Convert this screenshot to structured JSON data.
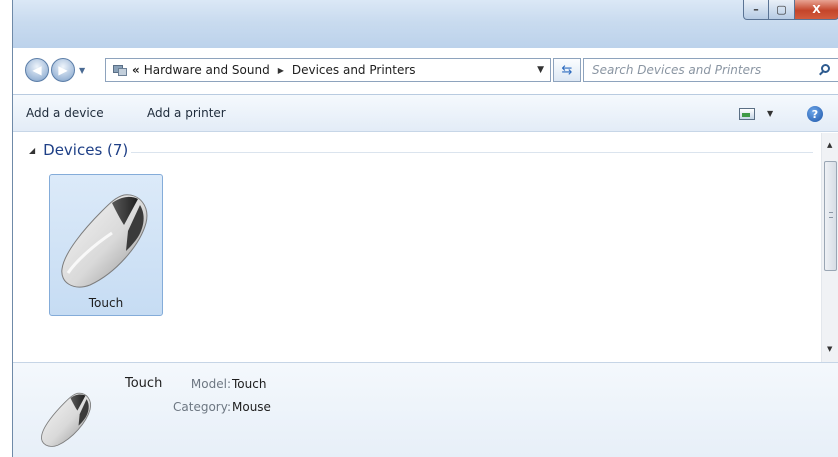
{
  "window": {
    "caption": {
      "minimize_glyph": "–",
      "maximize_glyph": "▢",
      "close_glyph": "X"
    }
  },
  "nav": {
    "back_glyph": "◀",
    "forward_glyph": "▶"
  },
  "address": {
    "overflow_chevron": "«",
    "breadcrumbs": [
      "Hardware and Sound",
      "Devices and Printers"
    ],
    "separator_glyph": "▶",
    "dropdown_glyph": "▼",
    "refresh_glyph": "⇆"
  },
  "search": {
    "placeholder": "Search Devices and Printers"
  },
  "commandbar": {
    "add_device": "Add a device",
    "add_printer": "Add a printer",
    "view_dropdown_glyph": "▼",
    "help_glyph": "?"
  },
  "content": {
    "group": {
      "arrow_glyph": "◢",
      "title": "Devices (7)"
    },
    "devices": [
      {
        "label": "Touch",
        "icon": "mouse-icon"
      }
    ]
  },
  "scrollbar": {
    "up_glyph": "▲",
    "down_glyph": "▼"
  },
  "details": {
    "name": "Touch",
    "model_label": "Model:",
    "model_value": "Touch",
    "category_label": "Category:",
    "category_value": "Mouse"
  },
  "colors": {
    "accent_blue": "#1e3f86",
    "selection_fill": "#c6dcf3",
    "selection_border": "#84acd9"
  }
}
